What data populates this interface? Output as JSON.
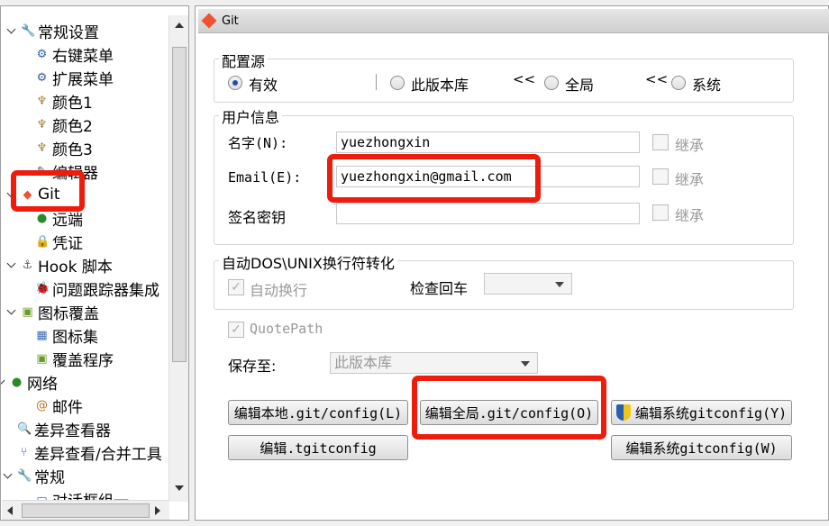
{
  "tree": {
    "items": [
      {
        "label": "常规设置",
        "icon": "wrench-icon"
      },
      {
        "label": "右键菜单",
        "icon": "gear-icon"
      },
      {
        "label": "扩展菜单",
        "icon": "gear-icon"
      },
      {
        "label": "颜色1",
        "icon": "palette-icon"
      },
      {
        "label": "颜色2",
        "icon": "palette-icon"
      },
      {
        "label": "颜色3",
        "icon": "palette-icon"
      },
      {
        "label": "编辑器",
        "icon": "editor-icon"
      },
      {
        "label": "Git",
        "icon": "git-icon"
      },
      {
        "label": "远端",
        "icon": "remote-icon"
      },
      {
        "label": "凭证",
        "icon": "lock-icon"
      },
      {
        "label": "Hook 脚本",
        "icon": "hook-icon"
      },
      {
        "label": "问题跟踪器集成",
        "icon": "bug-icon"
      },
      {
        "label": "图标覆盖",
        "icon": "overlay-icon"
      },
      {
        "label": "图标集",
        "icon": "iconset-icon"
      },
      {
        "label": "覆盖程序",
        "icon": "overlay-icon"
      },
      {
        "label": "网络",
        "icon": "network-icon"
      },
      {
        "label": "邮件",
        "icon": "mail-icon"
      },
      {
        "label": "差异查看器",
        "icon": "diff-icon"
      },
      {
        "label": "差异查看/合并工具",
        "icon": "merge-icon"
      },
      {
        "label": "常规",
        "icon": "wrench-icon"
      },
      {
        "label": "对话框组一",
        "icon": "dialog-icon"
      }
    ]
  },
  "panel": {
    "title": "Git",
    "config_source": {
      "legend": "配置源",
      "options": [
        "有效",
        "此版本库",
        "全局",
        "系统"
      ],
      "selected": "有效",
      "arrow_glyph": "<<"
    },
    "user_info": {
      "legend": "用户信息",
      "name_label": "名字(N):",
      "name_value": "yuezhongxin",
      "email_label": "Email(E):",
      "email_value": "yuezhongxin@gmail.com",
      "key_label": "签名密钥",
      "key_value": "",
      "inherit_label": "继承"
    },
    "eol": {
      "legend": "自动DOS\\UNIX换行符转化",
      "autocrlf_label": "自动换行",
      "safecrlf_label": "检查回车",
      "safecrlf_value": ""
    },
    "quotepath_label": "QuotePath",
    "save_to_label": "保存至:",
    "save_to_value": "此版本库",
    "buttons": {
      "edit_local": "编辑本地.git/config(L)",
      "edit_global": "编辑全局.git/config(O)",
      "edit_system": "编辑系统gitconfig(Y)",
      "edit_tgit": "编辑.tgitconfig",
      "edit_system_w": "编辑系统gitconfig(W)"
    }
  },
  "colors": {
    "highlight": "#ee1c0c",
    "radio_dot": "#1f4fa5"
  }
}
